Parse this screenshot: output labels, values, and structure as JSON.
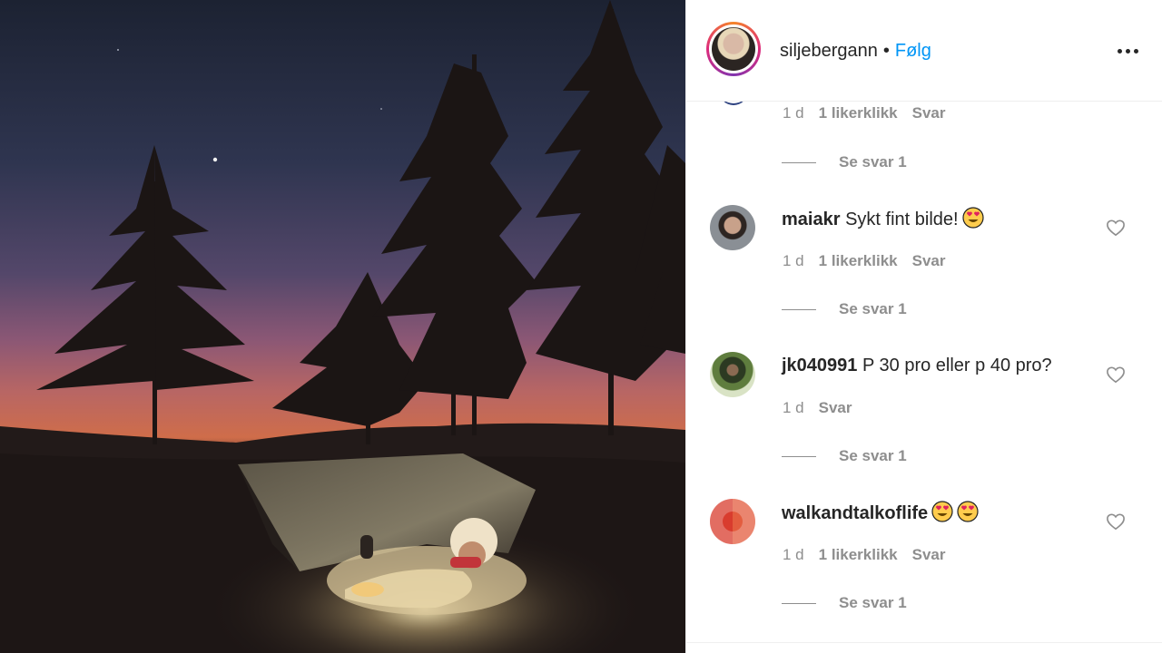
{
  "post": {
    "author": "siljebergann",
    "separator": "•",
    "follow_label": "Følg",
    "more_label": "More options"
  },
  "top_comment_tail": {
    "time": "1 d",
    "likes": "1 likerklikk",
    "reply": "Svar",
    "view_replies": "Se svar 1"
  },
  "comments": [
    {
      "username": "maiakr",
      "text": "Sykt fint bilde!",
      "emoji": "heart-eyes-emoji",
      "time": "1 d",
      "likes": "1 likerklikk",
      "reply": "Svar",
      "view_replies": "Se svar 1"
    },
    {
      "username": "jk040991",
      "text": "P 30 pro eller p 40 pro?",
      "time": "1 d",
      "reply": "Svar",
      "view_replies": "Se svar 1"
    },
    {
      "username": "walkandtalkoflife",
      "text": "",
      "emoji": "heart-eyes-emoji x2",
      "time": "1 d",
      "likes": "1 likerklikk",
      "reply": "Svar",
      "view_replies": "Se svar 1"
    }
  ],
  "colors": {
    "link_blue": "#0095f6",
    "text_primary": "#262626",
    "text_secondary": "#8e8e8e",
    "divider": "#efefef"
  }
}
